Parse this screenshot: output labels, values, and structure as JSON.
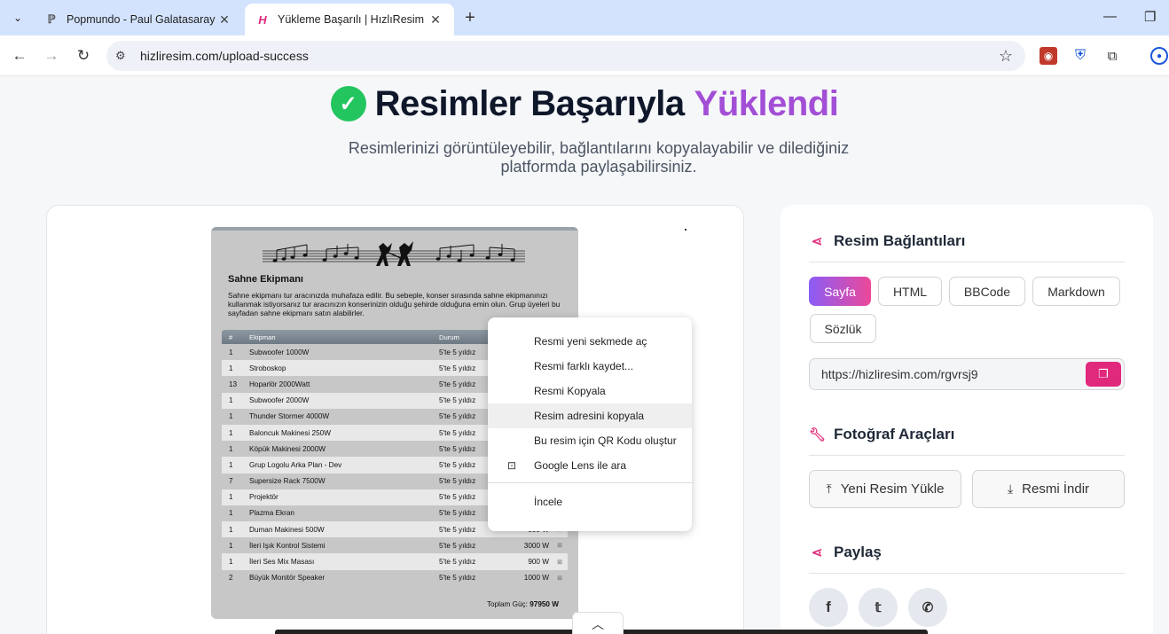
{
  "browser": {
    "tabs": [
      {
        "title": "Popmundo - Paul Galatasaray",
        "favicon": "popmundo-icon"
      },
      {
        "title": "Yükleme Başarılı | HızlıResim",
        "favicon": "hizliresim-icon"
      }
    ],
    "url": "hizliresim.com/upload-success"
  },
  "page": {
    "title_main": "Resimler Başarıyla",
    "title_accent": "Yüklendi",
    "subtitle": "Resimlerinizi görüntüleyebilir, bağlantılarını kopyalayabilir ve dilediğiniz platformda paylaşabilirsiniz.",
    "accent_color": "#a24fd6",
    "pink_color": "#e0287d",
    "success_color": "#22c55e"
  },
  "preview": {
    "heading": "Sahne Ekipmanı",
    "description": "Sahne ekipmanı tur aracınızda muhafaza edilir. Bu sebeple, konser sırasında sahne ekipmanınızı kullanmak istiyorsanız tur aracınızın konserinizin olduğu şehirde olduğuna emin olun. Grup üyeleri bu sayfadan sahne ekipmanı satın alabilirler.",
    "columns": [
      "#",
      "Ekipman",
      "Durum",
      "",
      ""
    ],
    "rows": [
      [
        "1",
        "Subwoofer 1000W",
        "5'te 5 yıldız",
        "",
        ""
      ],
      [
        "1",
        "Stroboskop",
        "5'te 5 yıldız",
        "",
        ""
      ],
      [
        "13",
        "Hoparlör 2000Watt",
        "5'te 5 yıldız",
        "",
        ""
      ],
      [
        "1",
        "Subwoofer 2000W",
        "5'te 5 yıldız",
        "",
        ""
      ],
      [
        "1",
        "Thunder Stormer 4000W",
        "5'te 5 yıldız",
        "",
        ""
      ],
      [
        "1",
        "Baloncuk Makinesi 250W",
        "5'te 5 yıldız",
        "",
        ""
      ],
      [
        "1",
        "Köpük Makinesi 2000W",
        "5'te 5 yıldız",
        "",
        ""
      ],
      [
        "1",
        "Grup Logolu Arka Plan - Dev",
        "5'te 5 yıldız",
        "",
        ""
      ],
      [
        "7",
        "Supersize Rack 7500W",
        "5'te 5 yıldız",
        "",
        ""
      ],
      [
        "1",
        "Projektör",
        "5'te 5 yıldız",
        "",
        ""
      ],
      [
        "1",
        "Plazma Ekran",
        "5'te 5 yıldız",
        "",
        ""
      ],
      [
        "1",
        "Duman Makinesi 500W",
        "5'te 5 yıldız",
        "500 W",
        "⊠"
      ],
      [
        "1",
        "İleri Işık Kontrol Sistemi",
        "5'te 5 yıldız",
        "3000 W",
        "⊠"
      ],
      [
        "1",
        "İleri Ses Mix Masası",
        "5'te 5 yıldız",
        "900 W",
        "⊠"
      ],
      [
        "2",
        "Büyük Monitör Speaker",
        "5'te 5 yıldız",
        "1000 W",
        "⊠"
      ]
    ],
    "total_label": "Toplam Güç:",
    "total_value": "97950 W"
  },
  "context_menu": {
    "items": [
      "Resmi yeni sekmede aç",
      "Resmi farklı kaydet...",
      "Resmi Kopyala",
      "Resim adresini kopyala",
      "Bu resim için QR Kodu oluştur",
      "Google Lens ile ara",
      "İncele"
    ],
    "hovered_index": 3
  },
  "links_section": {
    "title": "Resim Bağlantıları",
    "formats": [
      "Sayfa",
      "HTML",
      "BBCode",
      "Markdown",
      "Sözlük"
    ],
    "active_format": "Sayfa",
    "link_value": "https://hizliresim.com/rgvrsj9"
  },
  "tools_section": {
    "title": "Fotoğraf Araçları",
    "upload_label": "Yeni Resim Yükle",
    "download_label": "Resmi İndir"
  },
  "share_section": {
    "title": "Paylaş",
    "networks": [
      "facebook-icon",
      "twitter-icon",
      "whatsapp-icon"
    ]
  }
}
